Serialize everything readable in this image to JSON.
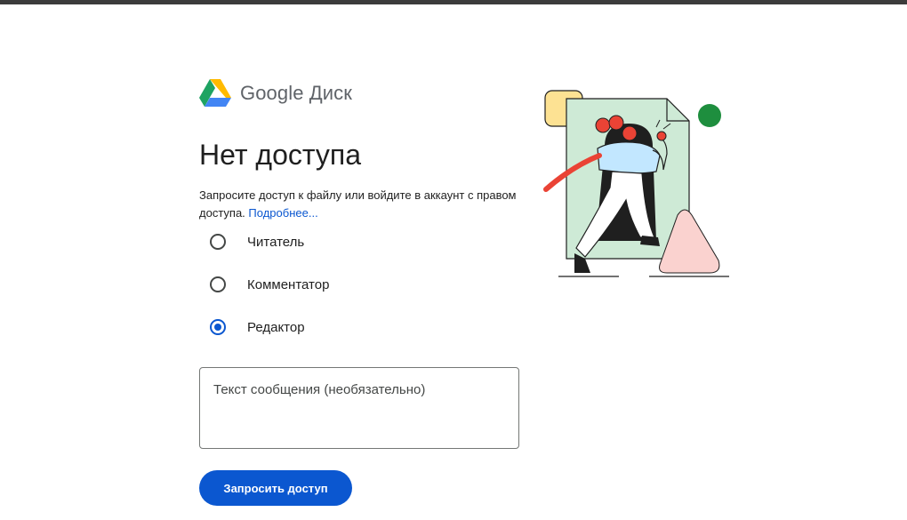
{
  "brand": {
    "google": "Google",
    "product": "Диск"
  },
  "heading": "Нет доступа",
  "description": {
    "text": "Запросите доступ к файлу или войдите в аккаунт с правом доступа.",
    "link": "Подробнее..."
  },
  "roles": {
    "selected": "Редактор",
    "options": [
      "Читатель",
      "Комментатор",
      "Редактор"
    ]
  },
  "message": {
    "placeholder": "Текст сообщения (необязательно)",
    "value": ""
  },
  "request_button": "Запросить доступ",
  "colors": {
    "accent": "#0b57d0",
    "drive_green": "#1ea362",
    "drive_yellow": "#ffba00",
    "drive_blue": "#4285f4",
    "illustration_green": "#ceead6",
    "illustration_yellow": "#fde293",
    "illustration_red": "#ea4335",
    "illustration_pink": "#fad2cf",
    "illustration_blue": "#c2e7ff"
  },
  "icons": [
    "google-drive-logo-icon",
    "access-denied-illustration"
  ]
}
